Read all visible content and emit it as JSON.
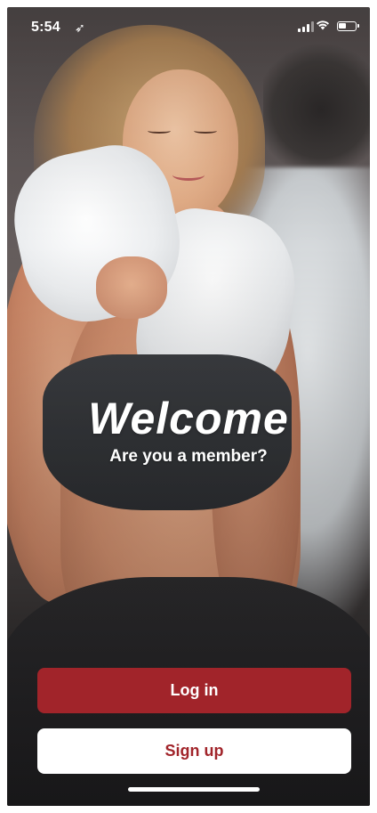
{
  "status_bar": {
    "time": "5:54",
    "location_icon": "location-arrow-icon",
    "signal_icon": "cellular-signal-icon",
    "wifi_icon": "wifi-icon",
    "battery_icon": "battery-icon"
  },
  "hero": {
    "title": "Welcome",
    "subtitle": "Are you a member?"
  },
  "actions": {
    "login_label": "Log in",
    "signup_label": "Sign up"
  },
  "colors": {
    "accent": "#a1242a",
    "button_text_light": "#ffffff"
  }
}
